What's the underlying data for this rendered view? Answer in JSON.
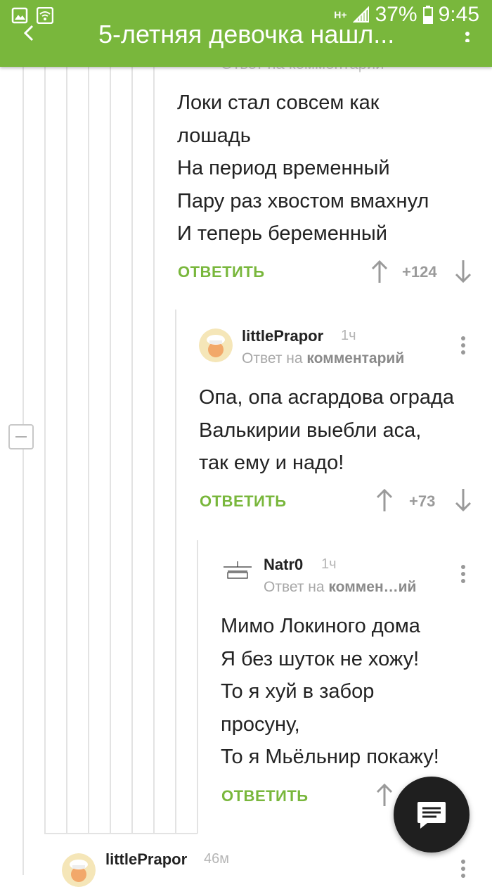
{
  "status_bar": {
    "network": "H+",
    "battery": "37%",
    "time": "9:45"
  },
  "app_bar": {
    "title": "5-летняя девочка нашл..."
  },
  "faded_header": "Ответ на комментарий",
  "comments": [
    {
      "text": "Локи стал совсем как\nлошадь\nНа период временный\nПару раз хвостом вмахнул\nИ теперь беременный",
      "reply_label": "ОТВЕТИТЬ",
      "score": "+124"
    },
    {
      "username": "littlePrapor",
      "time": "1ч",
      "reply_to_prefix": "Ответ на ",
      "reply_to_link": "комментарий",
      "text": "Опа, опа асгардова ограда\nВалькирии выебли аса,\nтак ему и надо!",
      "reply_label": "ОТВЕТИТЬ",
      "score": "+73"
    },
    {
      "username": "Natr0",
      "time": "1ч",
      "reply_to_prefix": "Ответ на ",
      "reply_to_link": "коммен…ий",
      "text": "Мимо Локиного дома\nЯ без шуток не хожу!\nТо я хуй в забор\nпросуну,\nТо я Мьёльнир покажу!",
      "reply_label": "ОТВЕТИТЬ"
    },
    {
      "username": "littlePrapor",
      "time": "46м"
    }
  ],
  "icons": {
    "status_left": [
      "gallery-icon",
      "wifi-icon"
    ],
    "fab": "message-icon"
  },
  "colors": {
    "accent": "#79b73c",
    "fab": "#1f1f1f"
  }
}
